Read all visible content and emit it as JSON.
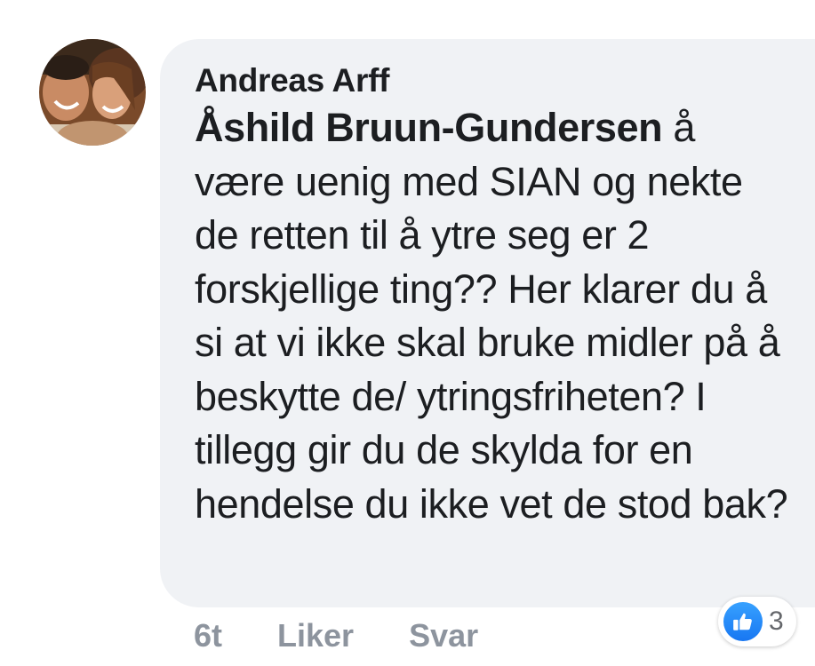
{
  "comment": {
    "author": "Andreas Arff",
    "mention": "Åshild Bruun-Gundersen",
    "text": " å være uenig med SIAN og nekte de retten til å ytre seg er 2 forskjellige ting?? Her klarer du å si at vi ikke skal bruke midler på å beskytte de/ ytringsfriheten? I tillegg gir du de skylda for en hendelse du ikke vet de stod bak?",
    "avatar_icon": "profile-photo"
  },
  "actions": {
    "time": "6t",
    "like_label": "Liker",
    "reply_label": "Svar"
  },
  "reactions": {
    "icon": "thumbs-up-icon",
    "count": "3",
    "color": "#1877f2"
  },
  "colors": {
    "bubble": "#f0f2f5",
    "text": "#1c1e21",
    "muted": "#8d949e"
  }
}
